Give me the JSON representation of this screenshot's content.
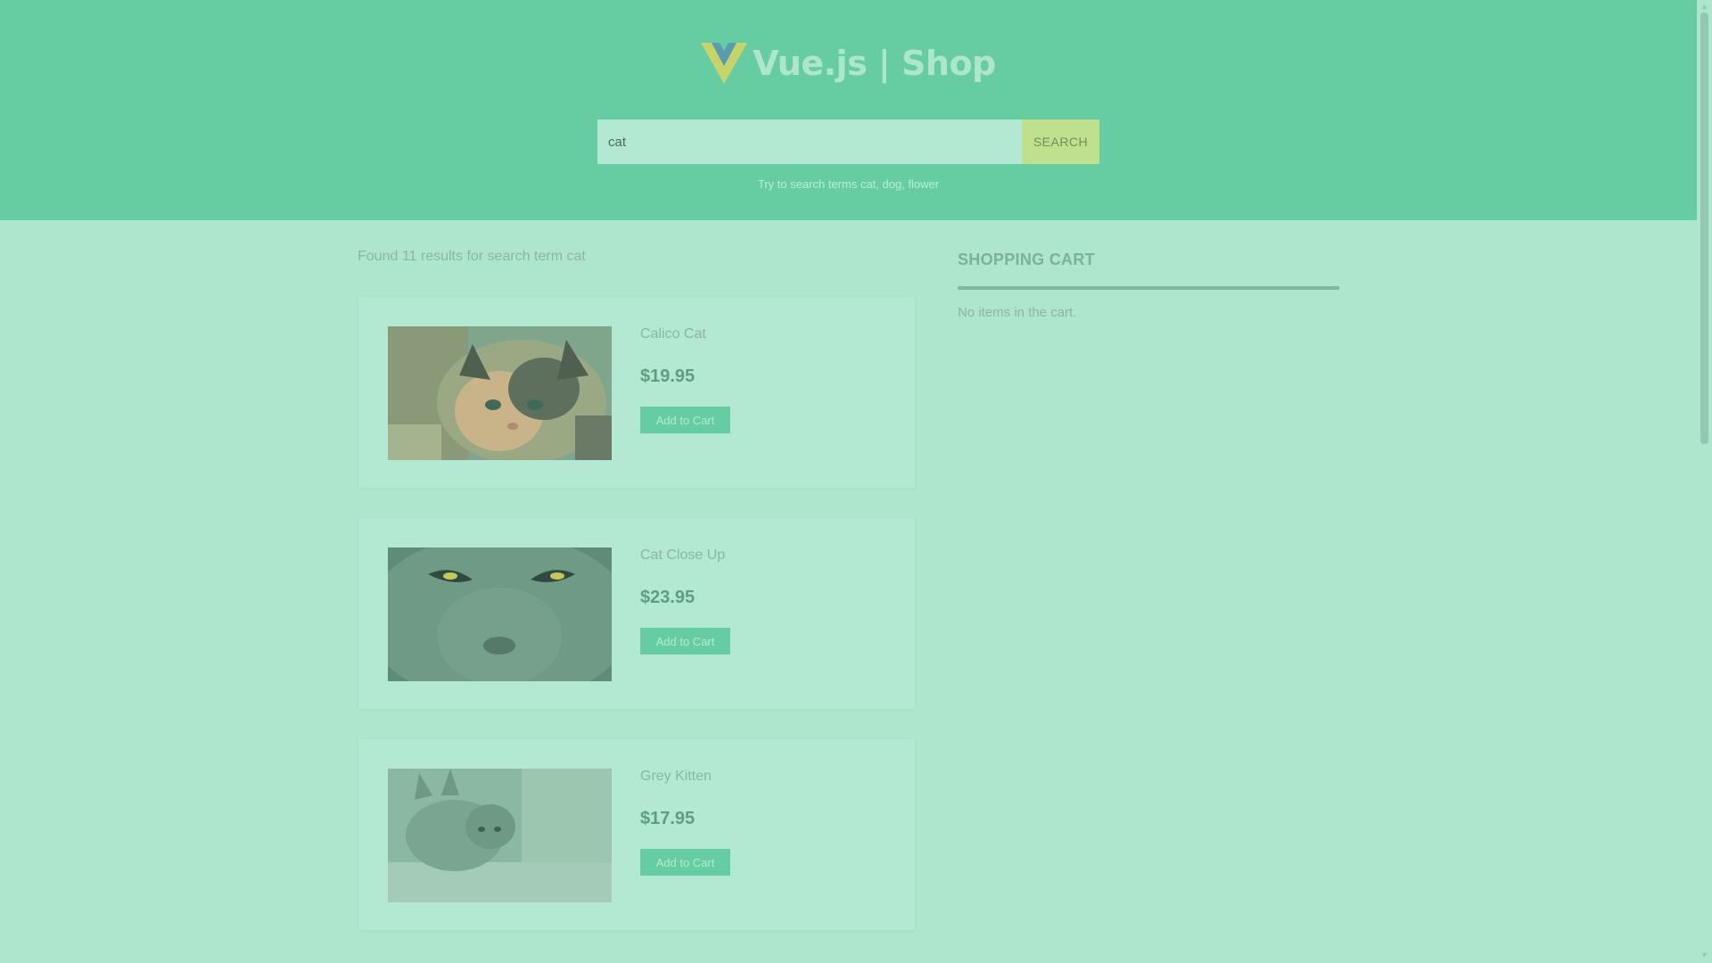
{
  "header": {
    "brand_title": "Vue.js | Shop",
    "brand_logo": "vue-logo-icon",
    "search": {
      "value": "cat",
      "placeholder": "",
      "button_label": "SEARCH"
    },
    "hint": "Try to search terms cat, dog, flower"
  },
  "results": {
    "summary": "Found 11 results for search term cat",
    "products": [
      {
        "name": "Calico Cat",
        "price": "$19.95",
        "button_label": "Add to Cart",
        "image": "calico-cat-photo"
      },
      {
        "name": "Cat Close Up",
        "price": "$23.95",
        "button_label": "Add to Cart",
        "image": "cat-close-up-photo"
      },
      {
        "name": "Grey Kitten",
        "price": "$17.95",
        "button_label": "Add to Cart",
        "image": "grey-kitten-photo"
      }
    ]
  },
  "cart": {
    "title": "SHOPPING CART",
    "empty_message": "No items in the cart."
  },
  "colors": {
    "header_bg": "#66cda2",
    "page_bg": "#aee6cd",
    "card_bg": "#b3e9d2",
    "accent": "#66cda2",
    "search_button_bg": "#bfe08d"
  }
}
